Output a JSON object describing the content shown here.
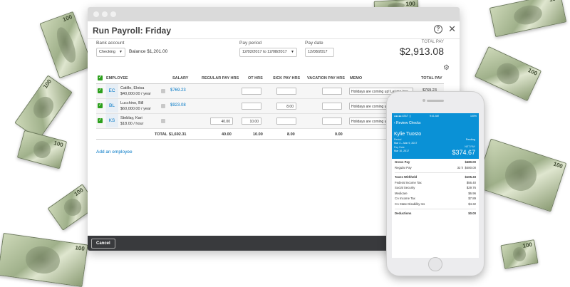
{
  "window": {
    "title": "Run Payroll: Friday",
    "bank_account_label": "Bank account",
    "bank_account_value": "Checking",
    "balance": "Balance $1,201.00",
    "pay_period_label": "Pay period",
    "pay_period_value": "12/02/2017 to 12/08/2017",
    "pay_date_label": "Pay date",
    "pay_date_value": "12/08/2017",
    "total_pay_label": "TOTAL PAY",
    "total_pay_value": "$2,913.08",
    "help_glyph": "?",
    "close_glyph": "✕",
    "gear_glyph": "⚙"
  },
  "table": {
    "headers": {
      "employee": "EMPLOYEE",
      "salary": "SALARY",
      "regular": "REGULAR PAY HRS",
      "ot": "OT HRS",
      "sick": "SICK PAY HRS",
      "vacation": "VACATION PAY HRS",
      "memo": "MEMO",
      "total": "TOTAL PAY"
    },
    "rows": [
      {
        "initials": "EC",
        "name": "Catillo, Eloisa",
        "rate": "$40,000.00 / year",
        "salary": "$769.23",
        "regular": "",
        "ot": "",
        "sick": "",
        "vacation": "",
        "memo": "Holidays are coming up! Let me kno",
        "total": "$769.23"
      },
      {
        "initials": "BL",
        "name": "Lucchino, Bill",
        "rate": "$60,000.00 / year",
        "salary": "$923.08",
        "regular": "",
        "ot": "",
        "sick": "8.00",
        "vacation": "",
        "memo": "Holidays are coming u",
        "total": ""
      },
      {
        "initials": "KS",
        "name": "Steblay, Kari",
        "rate": "$18.00 / hour",
        "salary": "",
        "regular": "40.00",
        "ot": "10.00",
        "sick": "",
        "vacation": "",
        "memo": "Holidays are coming u",
        "total": ""
      }
    ],
    "totals": {
      "label": "TOTAL",
      "salary": "$1,692.31",
      "regular": "40.00",
      "ot": "10.00",
      "sick": "8.00",
      "vacation": "0.00"
    },
    "add_employee": "Add an employee"
  },
  "footer": {
    "cancel_label": "Cancel"
  },
  "phone": {
    "status_left": "●●●●● AT&T ❙",
    "status_time": "9:41 AM",
    "status_right": "100%",
    "back_label": "‹  Review Checks",
    "employee_name": "Kylie Tuosto",
    "period_label": "Period",
    "period_value": "Mar 3 – Mar 9, 2017",
    "pay_date_label": "Pay Date",
    "pay_date_value": "Mar 10, 2017",
    "status_badge": "Pending",
    "net_pay_label": "NET PAY",
    "net_pay_value": "$374.67",
    "gross_pay_label": "Gross Pay",
    "gross_pay_value": "$480.00",
    "regular_pay_label": "Regular Pay",
    "regular_pay_hours": "32 h",
    "regular_pay_value": "$480.00",
    "taxes_label": "Taxes Withheld",
    "taxes_value": "$105.33",
    "tax_items": [
      {
        "label": "Federal Income Tax",
        "value": "$56.40"
      },
      {
        "label": "Social Security",
        "value": "$29.76"
      },
      {
        "label": "Medicare",
        "value": "$6.96"
      },
      {
        "label": "CA Income Tax",
        "value": "$7.89"
      },
      {
        "label": "CA State Disability Ins",
        "value": "$4.32"
      }
    ],
    "deductions_label": "Deductions",
    "deductions_value": "$0.00"
  }
}
